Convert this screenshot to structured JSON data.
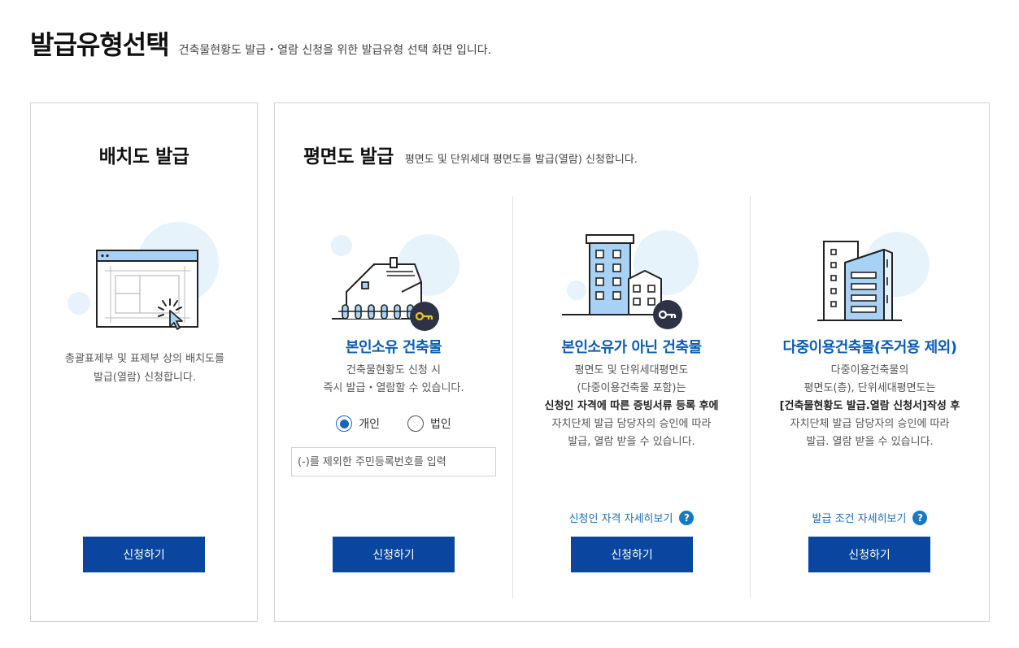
{
  "header": {
    "title": "발급유형선택",
    "subtitle": "건축물현황도 발급・열람 신청을 위한 발급유형 선택 화면 입니다."
  },
  "left_panel": {
    "title": "배치도 발급",
    "desc_line1": "총괄표제부 및 표제부 상의 배치도를",
    "desc_line2": "발급(열람) 신청합니다.",
    "button_label": "신청하기"
  },
  "right_panel": {
    "title": "평면도 발급",
    "subtitle": "평면도 및 단위세대 평면도를 발급(열람) 신청합니다.",
    "owned": {
      "title": "본인소유 건축물",
      "desc_line1": "건축물현황도 신청 시",
      "desc_line2": "즉시 발급・열람할 수 있습니다.",
      "radio_individual": "개인",
      "radio_corporation": "법인",
      "input_placeholder": "(-)를 제외한 주민등록번호를 입력",
      "button_label": "신청하기"
    },
    "not_owned": {
      "title": "본인소유가 아닌 건축물",
      "desc_line1": "평면도 및 단위세대평면도",
      "desc_line2": "(다중이용건축물 포함)는",
      "desc_line3": "신청인 자격에 따른 증빙서류 등록 후에",
      "desc_line4": "자치단체 발급 담당자의 승인에 따라",
      "desc_line5": "발급, 열람 받을 수 있습니다.",
      "link_label": "신청인 자격 자세히보기",
      "button_label": "신청하기"
    },
    "multi_use": {
      "title": "다중이용건축물(주거용 제외)",
      "desc_line1": "다중이용건축물의",
      "desc_line2": "평면도(층), 단위세대평면도는",
      "desc_line3": "[건축물현황도 발급.열람 신청서]작성 후",
      "desc_line4": "자치단체 발급 담당자의 승인에 따라",
      "desc_line5": "발급. 열람 받을 수 있습니다.",
      "link_label": "발급 조건 자세히보기",
      "button_label": "신청하기"
    }
  },
  "help_glyph": "?",
  "icons": {
    "left": "site-plan-icon",
    "owned": "house-key-icon",
    "not_owned": "buildings-key-icon",
    "multi_use": "tower-building-icon",
    "help": "question-circle-icon"
  },
  "colors": {
    "primary_button": "#0a46a0",
    "accent_text": "#0b5bb3",
    "link": "#1a6fb8",
    "illustration_fill": "#a8d2f5",
    "circle_bg": "#e6f3fb"
  }
}
